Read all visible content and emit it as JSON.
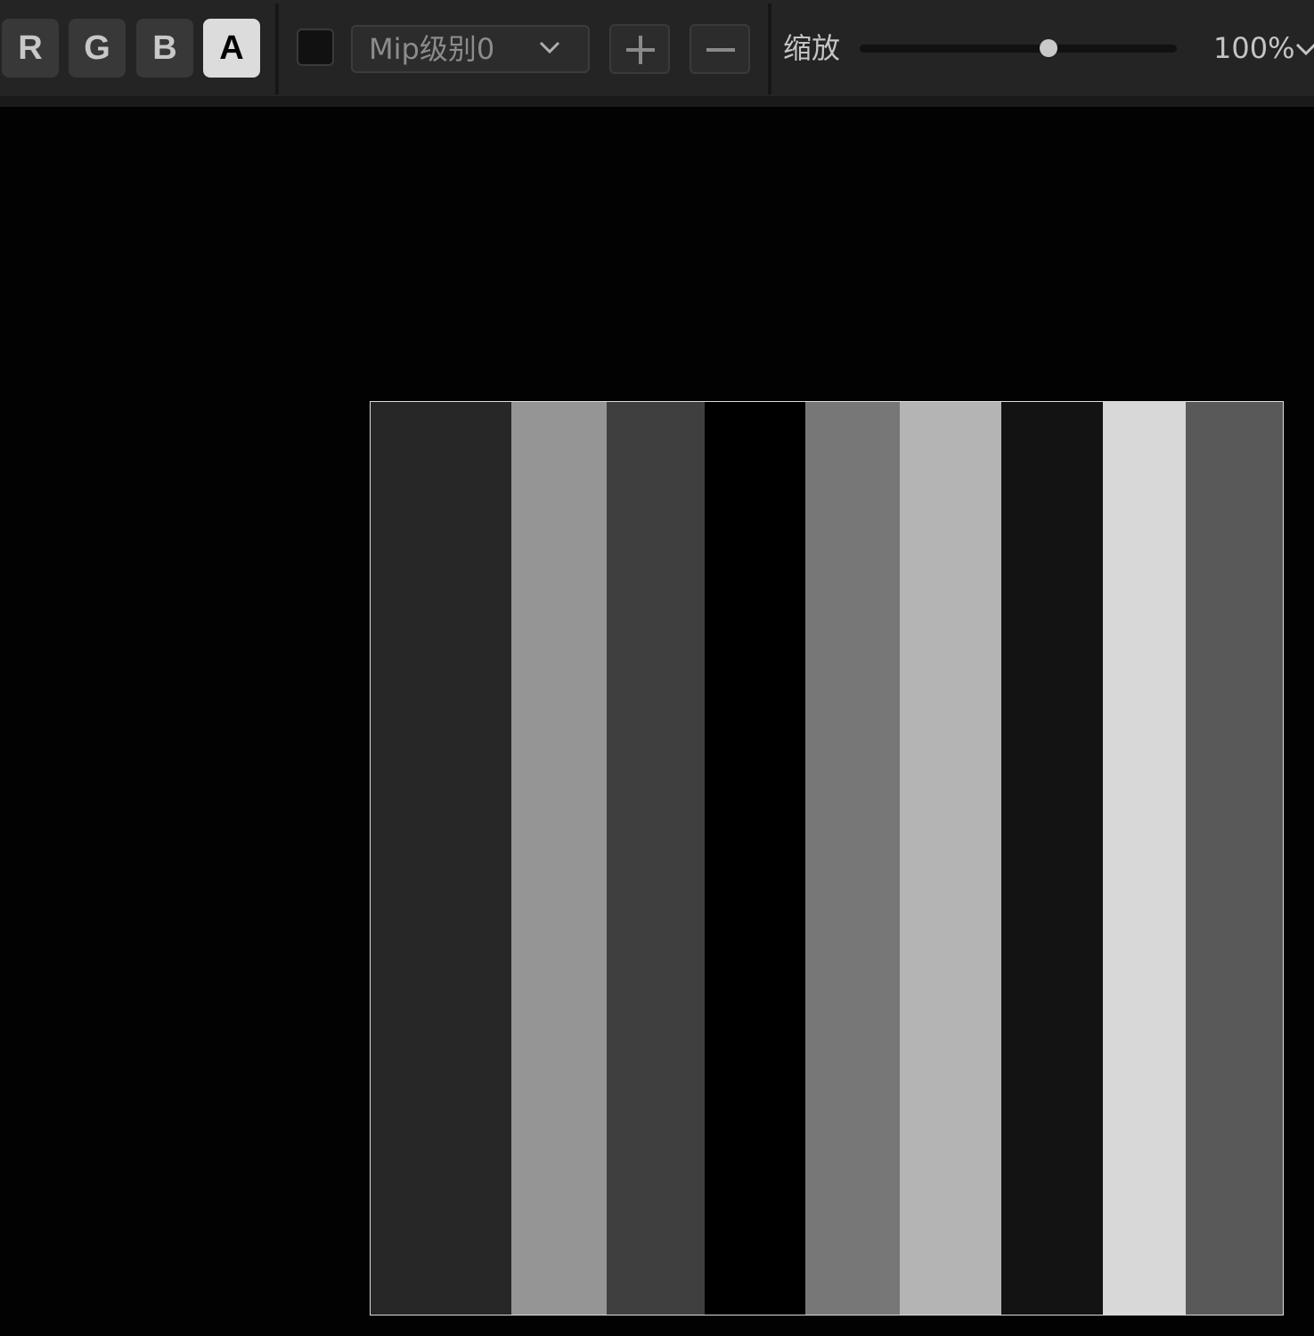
{
  "toolbar": {
    "channels": [
      {
        "label": "R",
        "active": false
      },
      {
        "label": "G",
        "active": false
      },
      {
        "label": "B",
        "active": false
      },
      {
        "label": "A",
        "active": true
      }
    ],
    "background_swatch_color": "#111111",
    "mip_select": {
      "value": "Mip级别0",
      "icon": "chevron-down-icon"
    },
    "add_icon": "plus-icon",
    "remove_icon": "minus-icon",
    "zoom": {
      "label": "缩放",
      "value_text": "100%",
      "slider_fraction": 0.595,
      "icon": "chevron-down-icon"
    }
  },
  "texture": {
    "stripe_colors": [
      "#272727",
      "#959595",
      "#3f3f3f",
      "#000000",
      "#777777",
      "#b4b4b4",
      "#131313",
      "#d8d8d8",
      "#595959"
    ],
    "border_color": "#dcdcdc"
  }
}
